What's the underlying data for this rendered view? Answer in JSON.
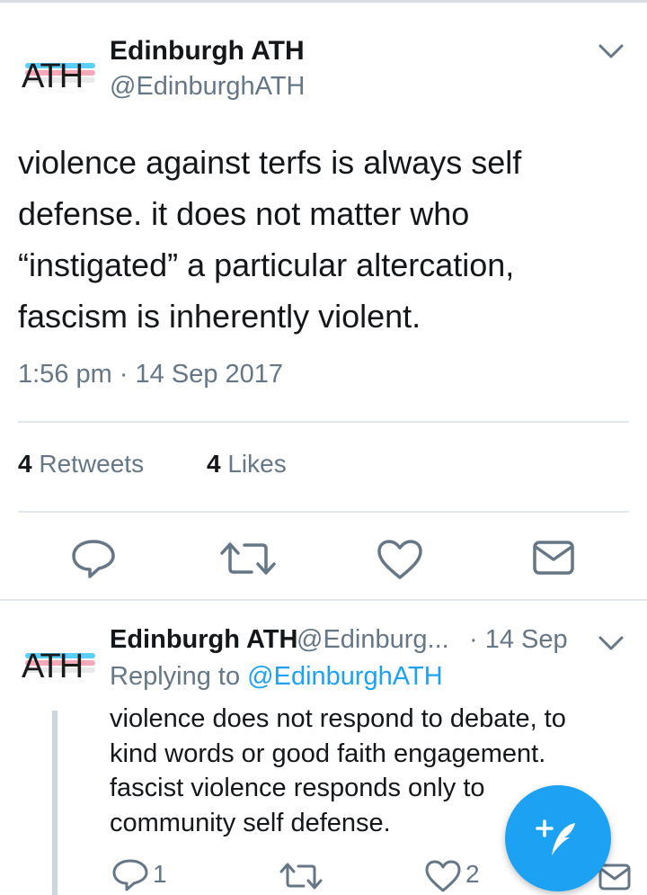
{
  "main_tweet": {
    "avatar_text": "ATH",
    "display_name": "Edinburgh ATH",
    "handle": "@EdinburghATH",
    "text": "violence against terfs is always self defense. it does not matter who “instigated” a particular altercation, fascism is inherently violent.",
    "timestamp": "1:56 pm · 14 Sep 2017",
    "retweets_count": "4",
    "retweets_label": "Retweets",
    "likes_count": "4",
    "likes_label": "Likes",
    "actions": [
      "reply-icon",
      "retweet-icon",
      "like-icon",
      "dm-icon"
    ]
  },
  "reply_tweet": {
    "avatar_text": "ATH",
    "display_name": "Edinburgh ATH",
    "handle": "@Edinburg...",
    "date": "· 14 Sep",
    "replying_prefix": "Replying to",
    "replying_to": "@EdinburghATH",
    "text": "violence does not respond to debate, to kind words or good faith engagement. fascist violence responds only to community self defense.",
    "reply_count": "1",
    "like_count": "2"
  },
  "colors": {
    "accent": "#1da1f2",
    "text": "#14171a",
    "muted": "#657786",
    "divider": "#e1e8ed"
  },
  "compose_button": {
    "icon": "compose-icon"
  }
}
